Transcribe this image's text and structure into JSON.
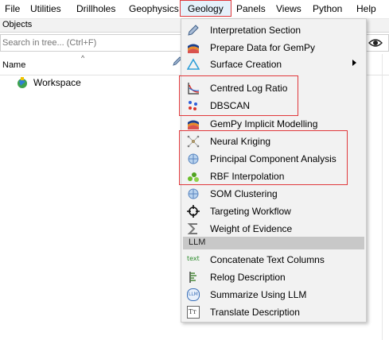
{
  "menubar": {
    "items": [
      "File",
      "Utilities",
      "Drillholes",
      "Geophysics",
      "Geology",
      "Panels",
      "Views",
      "Python",
      "Help"
    ],
    "active": "Geology"
  },
  "objects_panel": {
    "title": "Objects",
    "search_placeholder": "Search in tree... (Ctrl+F)",
    "column_name": "Name",
    "tree": [
      {
        "label": "Workspace",
        "icon": "workspace-globe-icon"
      }
    ]
  },
  "geology_menu": {
    "items": [
      {
        "label": "Interpretation Section",
        "icon": "pencil-icon"
      },
      {
        "label": "Prepare Data for GemPy",
        "icon": "gempy-icon"
      },
      {
        "label": "Surface Creation",
        "icon": "triangle-icon",
        "submenu": true
      },
      {
        "label": "Centred Log Ratio",
        "icon": "clr-chart-icon"
      },
      {
        "label": "DBSCAN",
        "icon": "dbscan-icon"
      },
      {
        "label": "GemPy Implicit Modelling",
        "icon": "gempy-icon"
      },
      {
        "label": "Neural Kriging",
        "icon": "neural-icon"
      },
      {
        "label": "Principal Component Analysis",
        "icon": "pca-icon"
      },
      {
        "label": "RBF Interpolation",
        "icon": "rbf-icon"
      },
      {
        "label": "SOM Clustering",
        "icon": "som-icon"
      },
      {
        "label": "Targeting Workflow",
        "icon": "target-icon"
      },
      {
        "label": "Weight of Evidence",
        "icon": "sigma-icon"
      }
    ],
    "llm_section": "LLM",
    "llm_items": [
      {
        "label": "Concatenate Text Columns",
        "icon": "text-icon",
        "icon_text": "text"
      },
      {
        "label": "Relog Description",
        "icon": "relog-icon"
      },
      {
        "label": "Summarize Using LLM",
        "icon": "llm-icon",
        "icon_text": "LLM"
      },
      {
        "label": "Translate Description",
        "icon": "translate-icon",
        "icon_text": "Tт"
      }
    ]
  },
  "colors": {
    "highlight_border": "#e0393c",
    "menu_background": "#f2f2f2",
    "section_background": "#c8c8c8",
    "active_menu_background": "#e5f1fb"
  }
}
